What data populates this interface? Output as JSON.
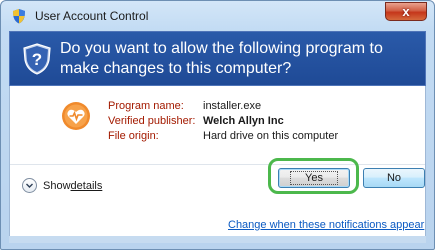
{
  "window": {
    "title": "User Account Control",
    "close_label": "x"
  },
  "header": {
    "question": "Do you want to allow the following program to make changes to this computer?"
  },
  "program": {
    "name_label": "Program name:",
    "name": "installer.exe",
    "publisher_label": "Verified publisher:",
    "publisher": "Welch Allyn Inc",
    "origin_label": "File origin:",
    "origin": "Hard drive on this computer",
    "icon": "heart-shield-icon"
  },
  "details": {
    "label_prefix": "Show ",
    "label_underlined": "details"
  },
  "buttons": {
    "yes": "Yes",
    "no": "No"
  },
  "link": "Change when these notifications appear",
  "colors": {
    "header_bg": "#1f4a96",
    "label_red": "#a31a00",
    "highlight": "#4cb84c",
    "link": "#0b5ac2"
  }
}
